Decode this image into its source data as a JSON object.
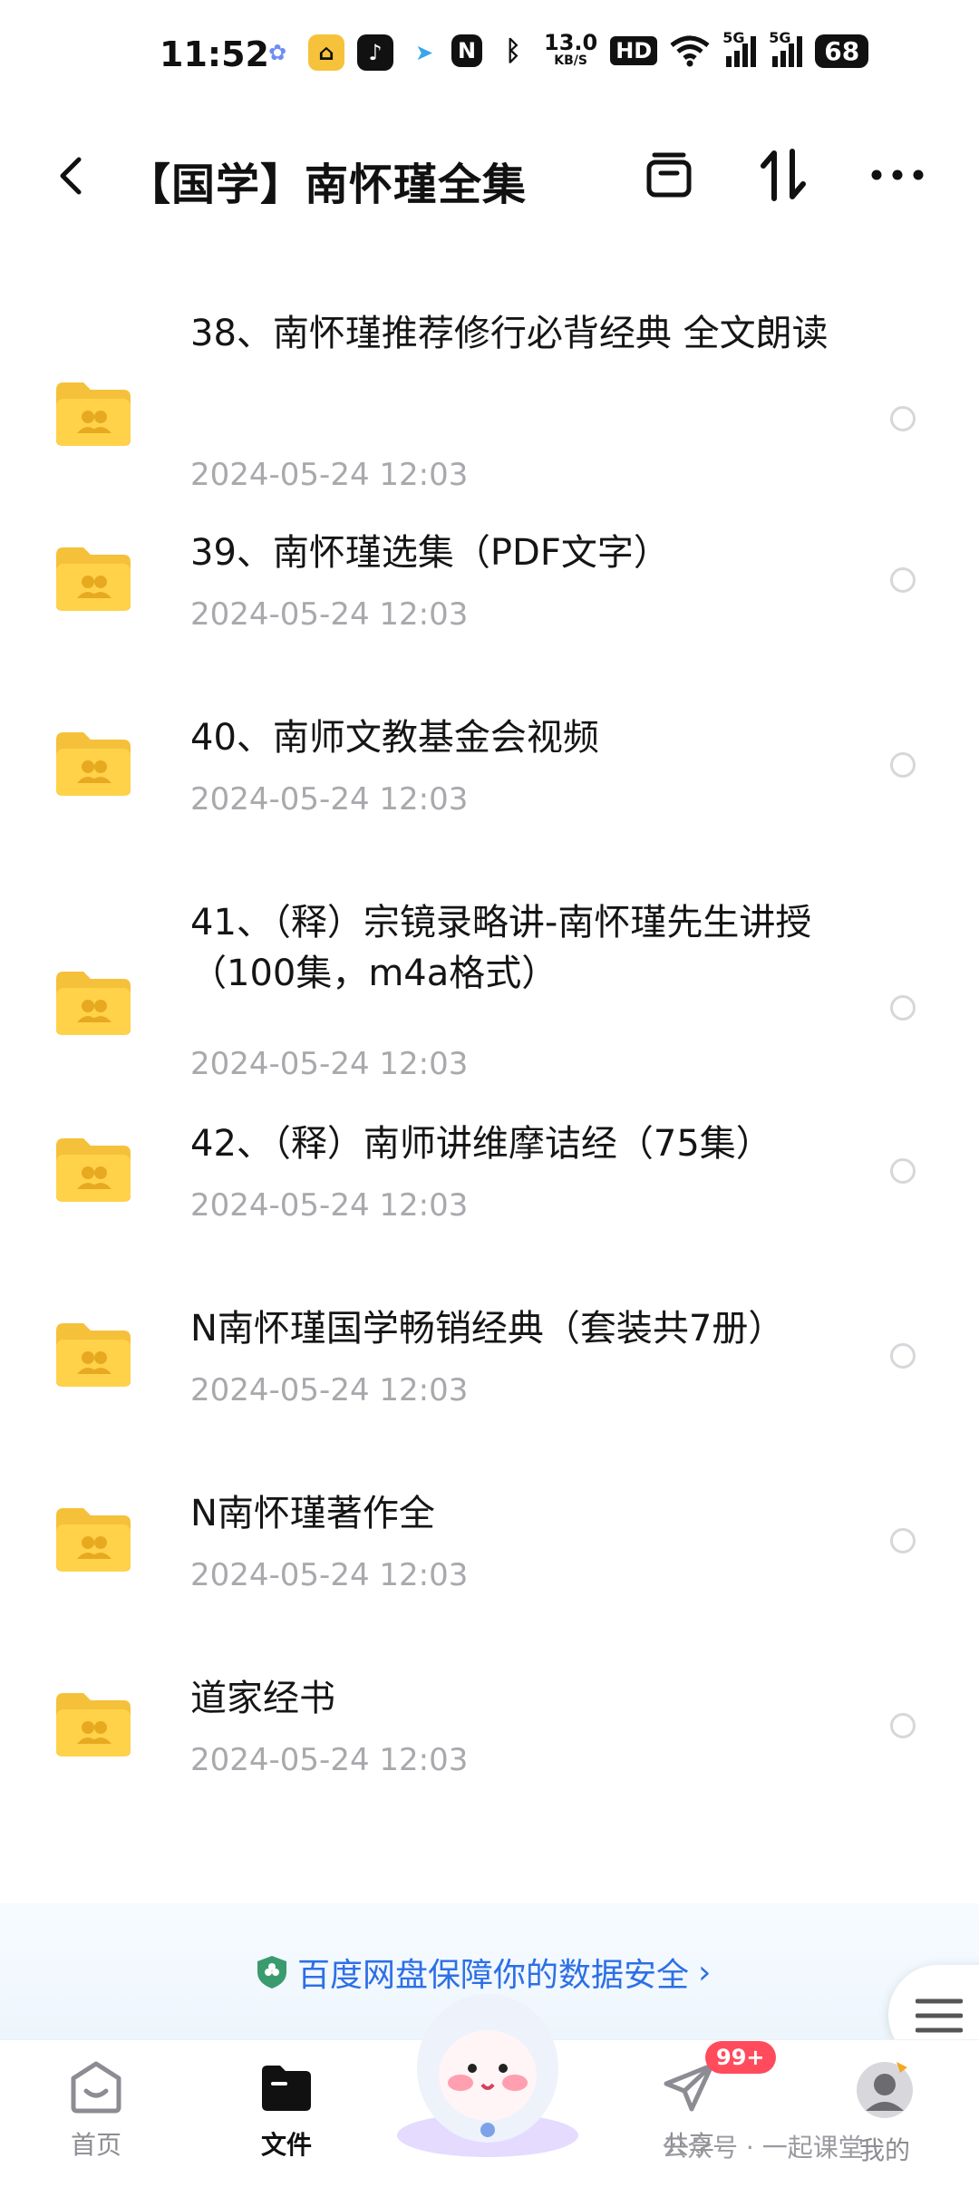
{
  "status_bar": {
    "time": "11:52",
    "net_speed_value": "13.0",
    "net_speed_unit": "KB/S",
    "hd_label": "HD",
    "signal1": "5G",
    "signal2": "5G",
    "battery": "68"
  },
  "header": {
    "title": "【国学】南怀瑾全集",
    "icons": [
      "back-icon",
      "select-all-icon",
      "sort-icon",
      "more-icon"
    ]
  },
  "files": [
    {
      "name": "38、南怀瑾推荐修行必背经典 全文朗读",
      "date": "2024-05-24  12:03"
    },
    {
      "name": "39、南怀瑾选集（PDF文字）",
      "date": "2024-05-24  12:03"
    },
    {
      "name": "40、南师文教基金会视频",
      "date": "2024-05-24  12:03"
    },
    {
      "name": "41、（释）宗镜录略讲-南怀瑾先生讲授（100集，m4a格式）",
      "date": "2024-05-24  12:03"
    },
    {
      "name": "42、（释）南师讲维摩诘经（75集）",
      "date": "2024-05-24  12:03"
    },
    {
      "name": "N南怀瑾国学畅销经典（套装共7册）",
      "date": "2024-05-24  12:03"
    },
    {
      "name": "N南怀瑾著作全",
      "date": "2024-05-24  12:03"
    },
    {
      "name": "道家经书",
      "date": "2024-05-24  12:03"
    }
  ],
  "banner": {
    "text": "百度网盘保障你的数据安全"
  },
  "bottom_nav": {
    "home": "首页",
    "files": "文件",
    "share": "共享",
    "share_badge": "99+",
    "mine": "我的"
  },
  "watermark": "公众号 · 一起课堂",
  "colors": {
    "folder": "#ffd24a",
    "accent": "#2d6fe6",
    "badge": "#ff4b5c",
    "date": "#a9a9ad"
  }
}
